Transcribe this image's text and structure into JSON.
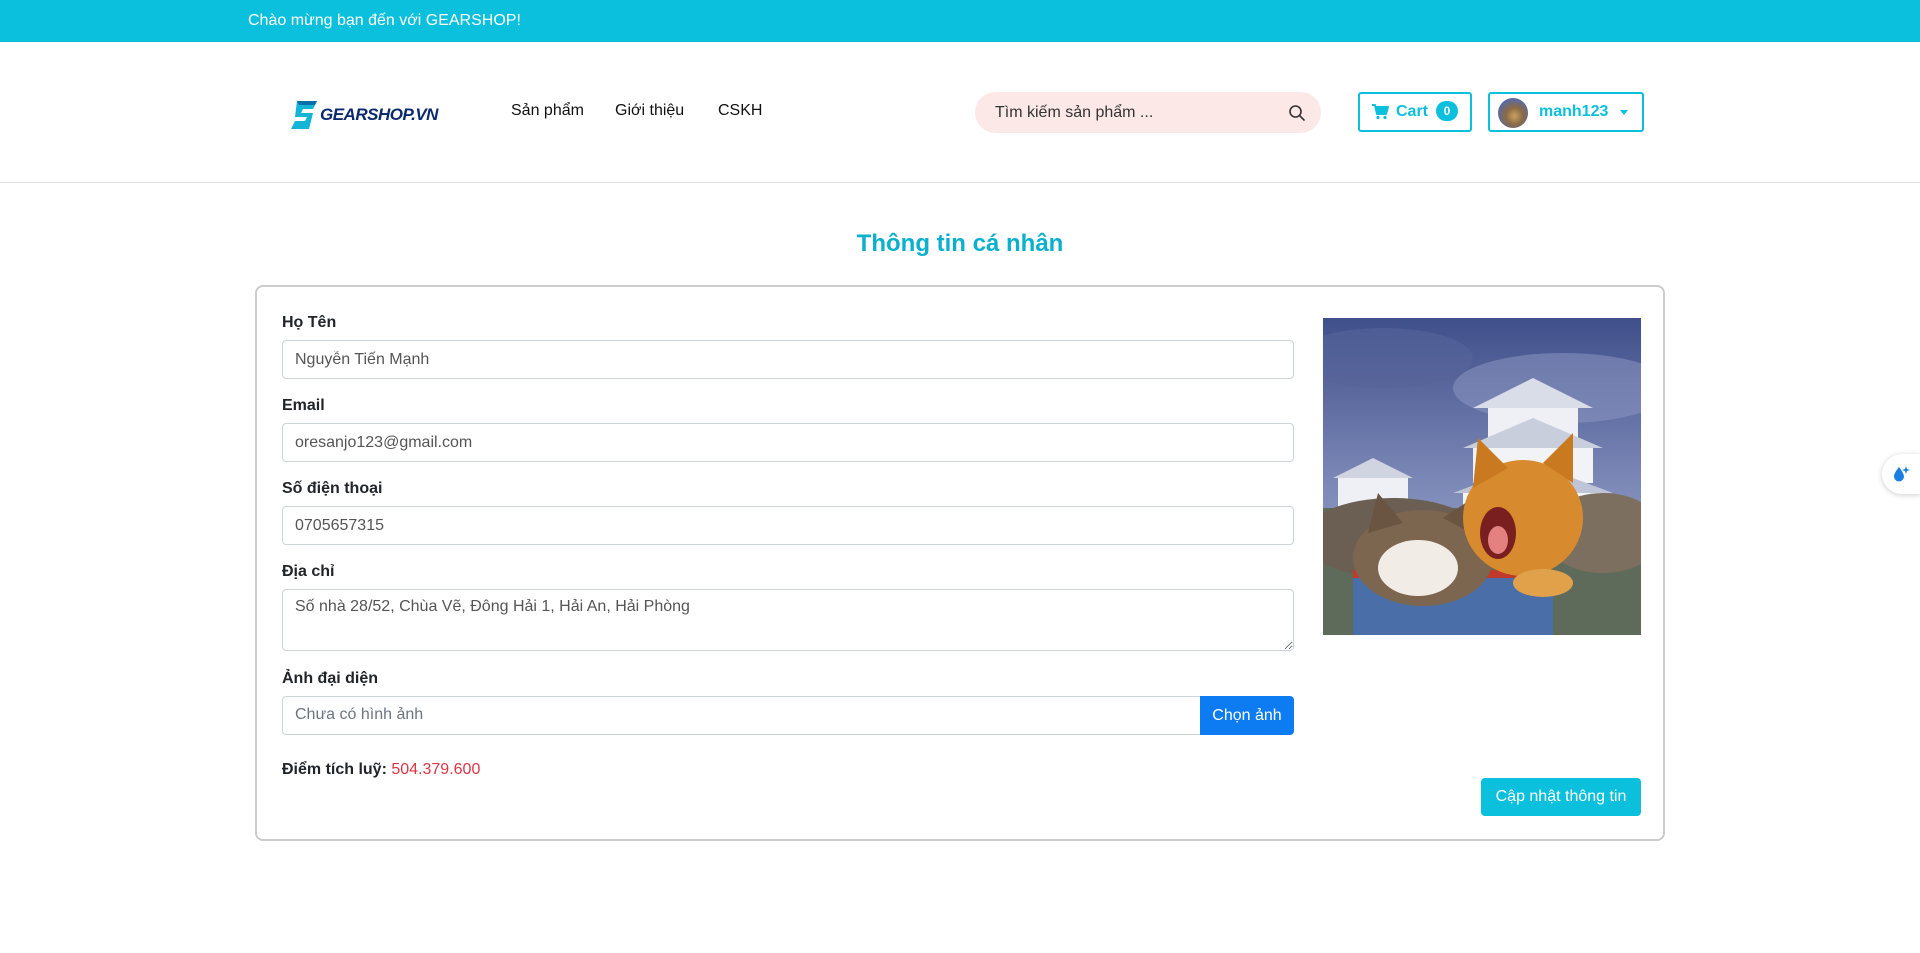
{
  "topbar": {
    "welcome": "Chào mừng bạn đến với GEARSHOP!"
  },
  "header": {
    "logo_text": "GEARSHOP.VN",
    "nav": [
      {
        "label": "Sản phẩm"
      },
      {
        "label": "Giới thiệu"
      },
      {
        "label": "CSKH"
      }
    ],
    "search": {
      "placeholder": "Tìm kiếm sản phẩm ...",
      "icon": "search-icon"
    },
    "cart": {
      "label": "Cart",
      "count": "0",
      "icon": "cart-icon"
    },
    "user": {
      "name": "manh123",
      "icon": "chevron-down-icon"
    }
  },
  "page": {
    "title": "Thông tin cá nhân",
    "form": {
      "name_label": "Họ Tên",
      "name_value": "Nguyễn Tiến Mạnh",
      "email_label": "Email",
      "email_value": "oresanjo123@gmail.com",
      "phone_label": "Số điện thoại",
      "phone_value": "0705657315",
      "address_label": "Địa chỉ",
      "address_value": "Số nhà 28/52, Chùa Vẽ, Đông Hải 1, Hải An, Hải Phòng",
      "avatar_label": "Ảnh đại diện",
      "avatar_placeholder": "Chưa có hình ảnh",
      "choose_button": "Chọn ảnh",
      "points_label": "Điểm tích luỹ:",
      "points_value": "504.379.600",
      "submit_button": "Cập nhật thông tin"
    }
  },
  "colors": {
    "accent": "#0bc0dd",
    "primary_button": "#0d7cf2",
    "points": "#dc3545",
    "search_bg": "#fde8e8"
  }
}
